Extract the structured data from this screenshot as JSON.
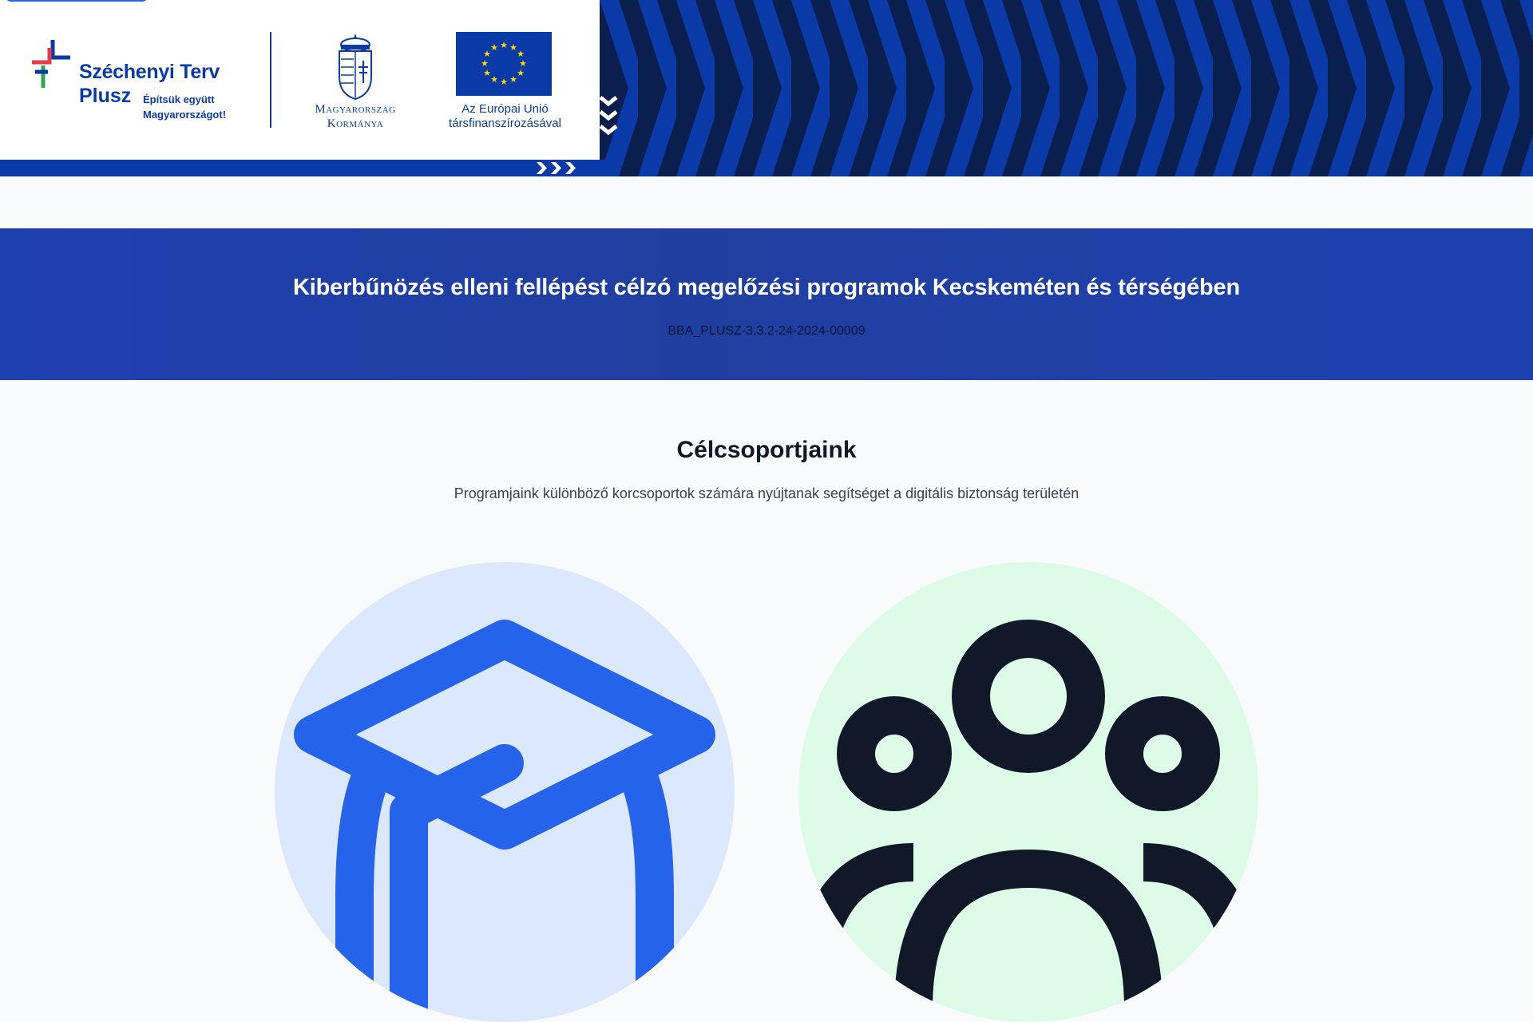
{
  "banner": {
    "szechenyi": {
      "title": "Széchenyi Terv",
      "plus": "Plusz",
      "slogan_line1": "Építsük együtt",
      "slogan_line2": "Magyarországot!"
    },
    "government": {
      "line1": "Magyarország",
      "line2": "Kormánya"
    },
    "eu": {
      "line1": "Az Európai Unió",
      "line2": "társfinanszírozásával"
    },
    "colors": {
      "brand_blue": "#0a3aa8",
      "stripe_dark": "#0b1f4f",
      "stripe_light": "#0a3aa8"
    }
  },
  "project": {
    "title": "Kiberbűnözés elleni fellépést célzó megelőzési programok Kecskeméten és térségében",
    "code": "BBA_PLUSZ-3.3.2-24-2024-00009"
  },
  "target_groups": {
    "title": "Célcsoportjaink",
    "subtitle": "Programjaink különböző korcsoportok számára nyújtanak segítséget a digitális biztonság területén",
    "cards": [
      {
        "icon": "graduation-cap-icon",
        "color": "#2563eb",
        "background": "#dbe8fd"
      },
      {
        "icon": "users-group-icon",
        "color": "#111827",
        "background": "#dcfce7"
      }
    ]
  }
}
